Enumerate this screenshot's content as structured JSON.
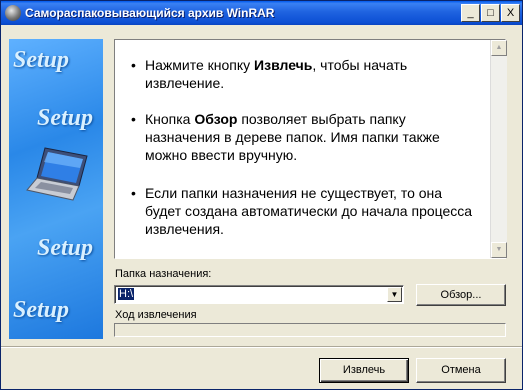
{
  "window": {
    "title": "Самораспаковывающийся архив WinRAR",
    "controls": {
      "minimize": "_",
      "maximize": "□",
      "close": "X"
    }
  },
  "banner": {
    "setup_labels": [
      "Setup",
      "Setup",
      "Setup",
      "Setup"
    ],
    "illustration": "laptop-icon"
  },
  "info": {
    "items": [
      [
        "Нажмите кнопку ",
        "Извлечь",
        ", чтобы начать извлечение."
      ],
      [
        "Кнопка ",
        "Обзор",
        " позволяет выбрать папку назначения в дереве папок. Имя папки также можно ввести вручную."
      ],
      [
        "Если папки назначения не существует, то она будет создана автоматически до начала процесса извлечения.",
        "",
        ""
      ]
    ]
  },
  "destination": {
    "label": "Папка назначения:",
    "value": "H:\\",
    "browse_label": "Обзор..."
  },
  "progress": {
    "label": "Ход извлечения",
    "value": 0
  },
  "footer": {
    "extract_label": "Извлечь",
    "cancel_label": "Отмена"
  },
  "colors": {
    "titlebar": "#0c4fd4",
    "banner": "#2a88e8",
    "face": "#ece9d8"
  }
}
